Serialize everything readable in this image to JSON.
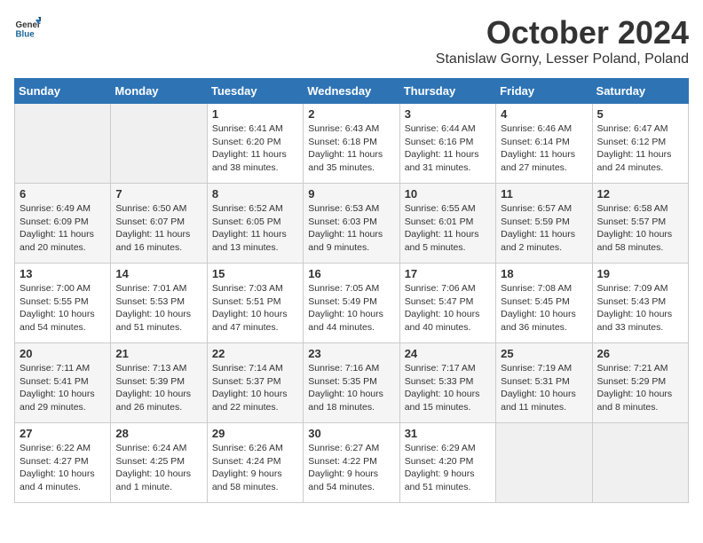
{
  "header": {
    "logo_general": "General",
    "logo_blue": "Blue",
    "month": "October 2024",
    "location": "Stanislaw Gorny, Lesser Poland, Poland"
  },
  "columns": [
    "Sunday",
    "Monday",
    "Tuesday",
    "Wednesday",
    "Thursday",
    "Friday",
    "Saturday"
  ],
  "weeks": [
    [
      {
        "day": "",
        "sunrise": "",
        "sunset": "",
        "daylight": ""
      },
      {
        "day": "",
        "sunrise": "",
        "sunset": "",
        "daylight": ""
      },
      {
        "day": "1",
        "sunrise": "Sunrise: 6:41 AM",
        "sunset": "Sunset: 6:20 PM",
        "daylight": "Daylight: 11 hours and 38 minutes."
      },
      {
        "day": "2",
        "sunrise": "Sunrise: 6:43 AM",
        "sunset": "Sunset: 6:18 PM",
        "daylight": "Daylight: 11 hours and 35 minutes."
      },
      {
        "day": "3",
        "sunrise": "Sunrise: 6:44 AM",
        "sunset": "Sunset: 6:16 PM",
        "daylight": "Daylight: 11 hours and 31 minutes."
      },
      {
        "day": "4",
        "sunrise": "Sunrise: 6:46 AM",
        "sunset": "Sunset: 6:14 PM",
        "daylight": "Daylight: 11 hours and 27 minutes."
      },
      {
        "day": "5",
        "sunrise": "Sunrise: 6:47 AM",
        "sunset": "Sunset: 6:12 PM",
        "daylight": "Daylight: 11 hours and 24 minutes."
      }
    ],
    [
      {
        "day": "6",
        "sunrise": "Sunrise: 6:49 AM",
        "sunset": "Sunset: 6:09 PM",
        "daylight": "Daylight: 11 hours and 20 minutes."
      },
      {
        "day": "7",
        "sunrise": "Sunrise: 6:50 AM",
        "sunset": "Sunset: 6:07 PM",
        "daylight": "Daylight: 11 hours and 16 minutes."
      },
      {
        "day": "8",
        "sunrise": "Sunrise: 6:52 AM",
        "sunset": "Sunset: 6:05 PM",
        "daylight": "Daylight: 11 hours and 13 minutes."
      },
      {
        "day": "9",
        "sunrise": "Sunrise: 6:53 AM",
        "sunset": "Sunset: 6:03 PM",
        "daylight": "Daylight: 11 hours and 9 minutes."
      },
      {
        "day": "10",
        "sunrise": "Sunrise: 6:55 AM",
        "sunset": "Sunset: 6:01 PM",
        "daylight": "Daylight: 11 hours and 5 minutes."
      },
      {
        "day": "11",
        "sunrise": "Sunrise: 6:57 AM",
        "sunset": "Sunset: 5:59 PM",
        "daylight": "Daylight: 11 hours and 2 minutes."
      },
      {
        "day": "12",
        "sunrise": "Sunrise: 6:58 AM",
        "sunset": "Sunset: 5:57 PM",
        "daylight": "Daylight: 10 hours and 58 minutes."
      }
    ],
    [
      {
        "day": "13",
        "sunrise": "Sunrise: 7:00 AM",
        "sunset": "Sunset: 5:55 PM",
        "daylight": "Daylight: 10 hours and 54 minutes."
      },
      {
        "day": "14",
        "sunrise": "Sunrise: 7:01 AM",
        "sunset": "Sunset: 5:53 PM",
        "daylight": "Daylight: 10 hours and 51 minutes."
      },
      {
        "day": "15",
        "sunrise": "Sunrise: 7:03 AM",
        "sunset": "Sunset: 5:51 PM",
        "daylight": "Daylight: 10 hours and 47 minutes."
      },
      {
        "day": "16",
        "sunrise": "Sunrise: 7:05 AM",
        "sunset": "Sunset: 5:49 PM",
        "daylight": "Daylight: 10 hours and 44 minutes."
      },
      {
        "day": "17",
        "sunrise": "Sunrise: 7:06 AM",
        "sunset": "Sunset: 5:47 PM",
        "daylight": "Daylight: 10 hours and 40 minutes."
      },
      {
        "day": "18",
        "sunrise": "Sunrise: 7:08 AM",
        "sunset": "Sunset: 5:45 PM",
        "daylight": "Daylight: 10 hours and 36 minutes."
      },
      {
        "day": "19",
        "sunrise": "Sunrise: 7:09 AM",
        "sunset": "Sunset: 5:43 PM",
        "daylight": "Daylight: 10 hours and 33 minutes."
      }
    ],
    [
      {
        "day": "20",
        "sunrise": "Sunrise: 7:11 AM",
        "sunset": "Sunset: 5:41 PM",
        "daylight": "Daylight: 10 hours and 29 minutes."
      },
      {
        "day": "21",
        "sunrise": "Sunrise: 7:13 AM",
        "sunset": "Sunset: 5:39 PM",
        "daylight": "Daylight: 10 hours and 26 minutes."
      },
      {
        "day": "22",
        "sunrise": "Sunrise: 7:14 AM",
        "sunset": "Sunset: 5:37 PM",
        "daylight": "Daylight: 10 hours and 22 minutes."
      },
      {
        "day": "23",
        "sunrise": "Sunrise: 7:16 AM",
        "sunset": "Sunset: 5:35 PM",
        "daylight": "Daylight: 10 hours and 18 minutes."
      },
      {
        "day": "24",
        "sunrise": "Sunrise: 7:17 AM",
        "sunset": "Sunset: 5:33 PM",
        "daylight": "Daylight: 10 hours and 15 minutes."
      },
      {
        "day": "25",
        "sunrise": "Sunrise: 7:19 AM",
        "sunset": "Sunset: 5:31 PM",
        "daylight": "Daylight: 10 hours and 11 minutes."
      },
      {
        "day": "26",
        "sunrise": "Sunrise: 7:21 AM",
        "sunset": "Sunset: 5:29 PM",
        "daylight": "Daylight: 10 hours and 8 minutes."
      }
    ],
    [
      {
        "day": "27",
        "sunrise": "Sunrise: 6:22 AM",
        "sunset": "Sunset: 4:27 PM",
        "daylight": "Daylight: 10 hours and 4 minutes."
      },
      {
        "day": "28",
        "sunrise": "Sunrise: 6:24 AM",
        "sunset": "Sunset: 4:25 PM",
        "daylight": "Daylight: 10 hours and 1 minute."
      },
      {
        "day": "29",
        "sunrise": "Sunrise: 6:26 AM",
        "sunset": "Sunset: 4:24 PM",
        "daylight": "Daylight: 9 hours and 58 minutes."
      },
      {
        "day": "30",
        "sunrise": "Sunrise: 6:27 AM",
        "sunset": "Sunset: 4:22 PM",
        "daylight": "Daylight: 9 hours and 54 minutes."
      },
      {
        "day": "31",
        "sunrise": "Sunrise: 6:29 AM",
        "sunset": "Sunset: 4:20 PM",
        "daylight": "Daylight: 9 hours and 51 minutes."
      },
      {
        "day": "",
        "sunrise": "",
        "sunset": "",
        "daylight": ""
      },
      {
        "day": "",
        "sunrise": "",
        "sunset": "",
        "daylight": ""
      }
    ]
  ]
}
